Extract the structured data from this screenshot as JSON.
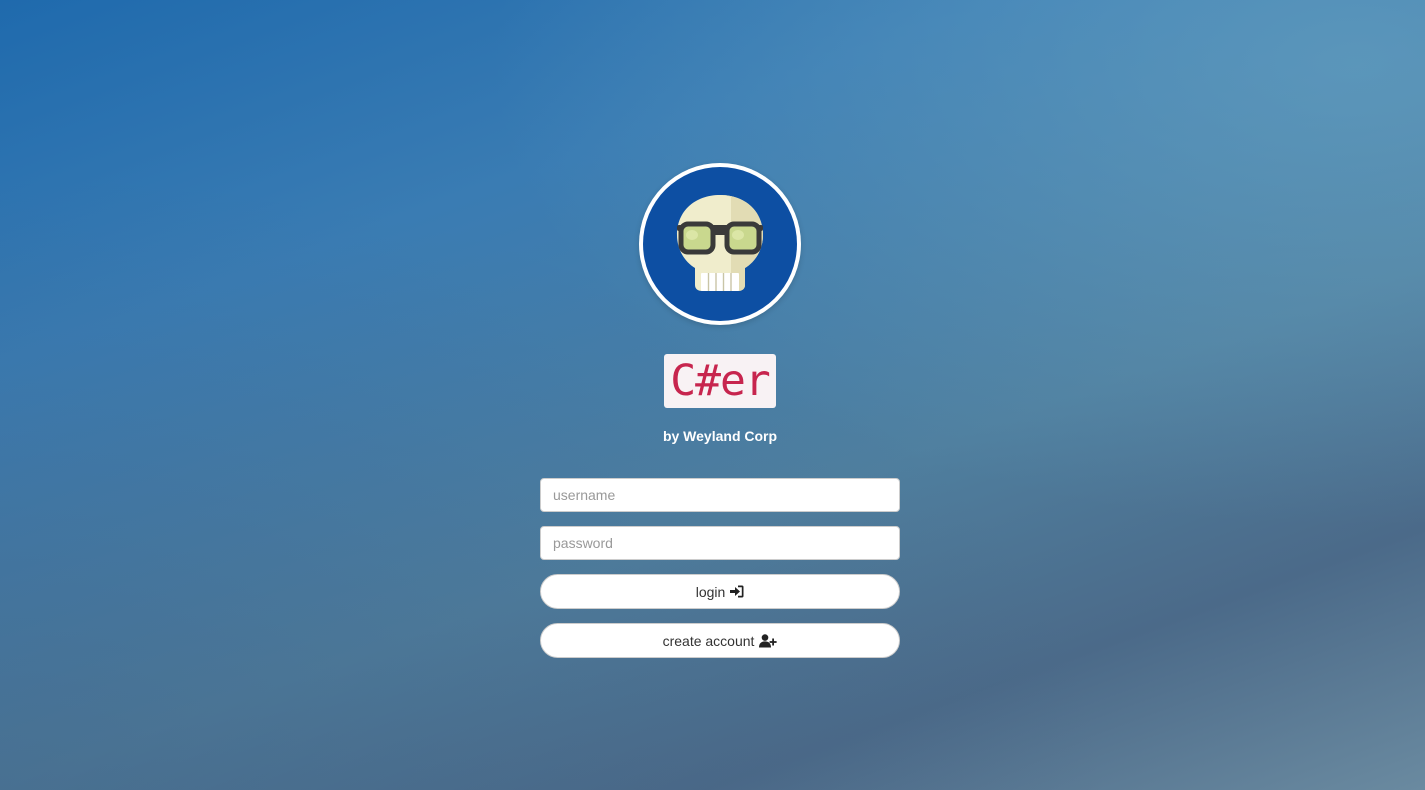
{
  "brand": {
    "name": "C#er",
    "byline": "by Weyland Corp",
    "logo_icon": "nerd-skull-icon",
    "name_color": "#c7254e",
    "logo_circle_color": "#0d4fa3"
  },
  "form": {
    "username_placeholder": "username",
    "username_value": "",
    "password_placeholder": "password",
    "password_value": "",
    "login_label": "login",
    "login_icon": "sign-in-icon",
    "create_label": "create account",
    "create_icon": "user-plus-icon"
  },
  "theme": {
    "background_start": "#1f6aad",
    "background_end": "#6a8aa0"
  }
}
